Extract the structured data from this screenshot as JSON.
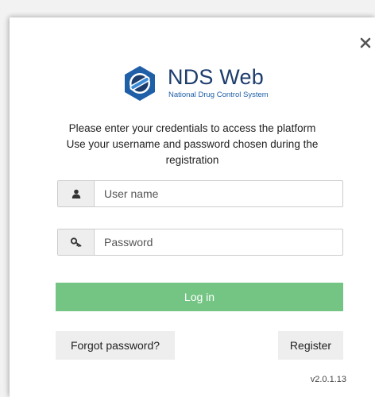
{
  "logo": {
    "name": "NDS Web",
    "subtitle": "National Drug Control System"
  },
  "intro": {
    "line1": "Please enter your credentials to access the platform",
    "line2": "Use your username and password chosen during the",
    "line3": "registration"
  },
  "form": {
    "username_placeholder": "User name",
    "password_placeholder": "Password",
    "user_icon": "user-icon",
    "password_icon": "key-icon"
  },
  "buttons": {
    "login": "Log in",
    "forgot": "Forgot password?",
    "register": "Register",
    "close_icon": "close-icon"
  },
  "version": "v2.0.1.13",
  "colors": {
    "login_button": "#74c583",
    "brand_dark": "#1d3d6d",
    "brand_blue": "#1f5fa8"
  }
}
